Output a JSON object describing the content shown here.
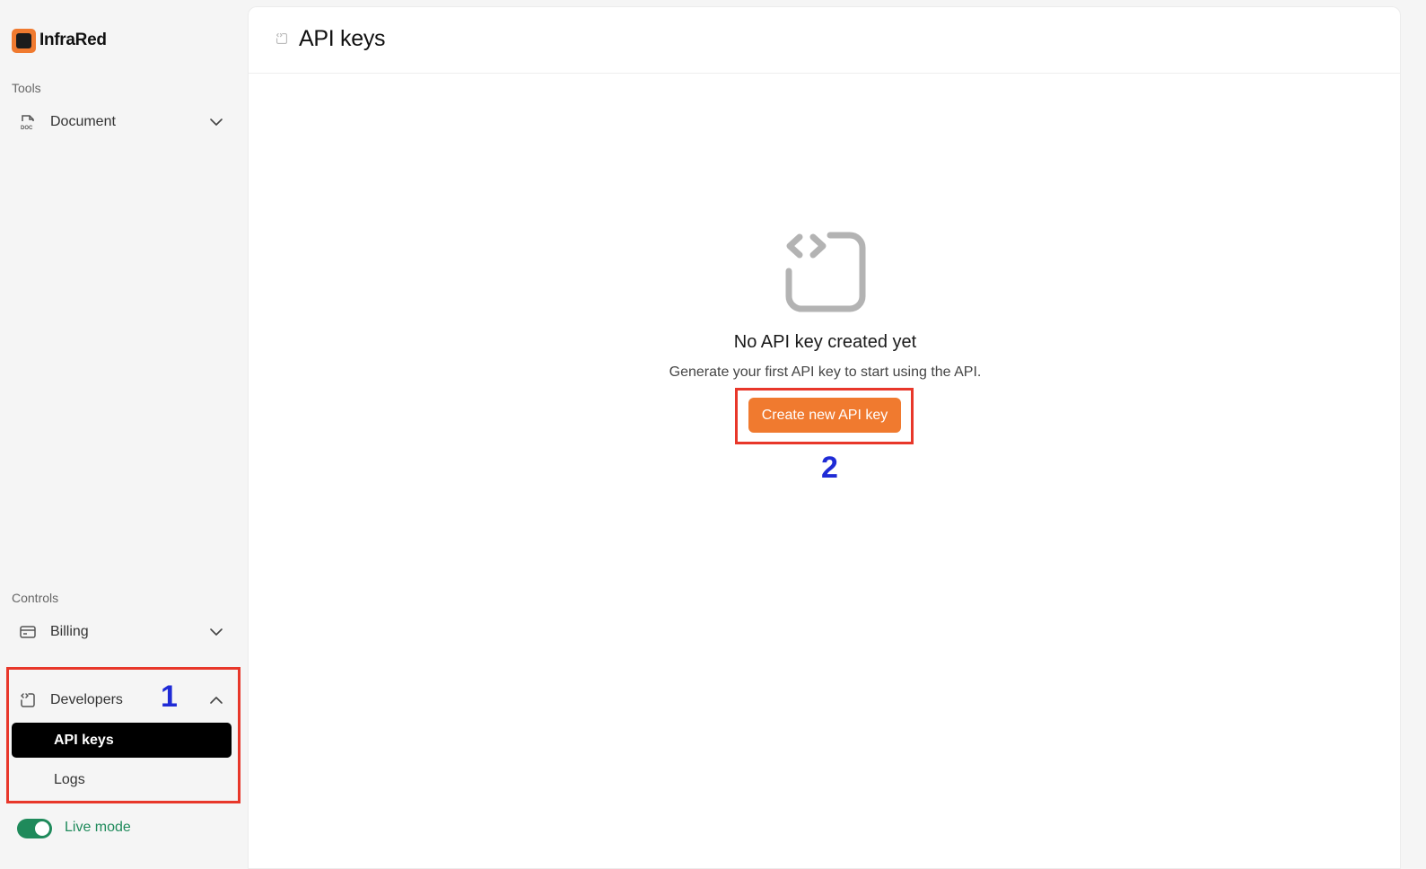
{
  "brand": {
    "name": "InfraRed"
  },
  "sidebar": {
    "tools_label": "Tools",
    "controls_label": "Controls",
    "items": [
      {
        "label": "Document",
        "icon": "doc-file-icon",
        "expanded": false
      },
      {
        "label": "Billing",
        "icon": "credit-card-icon",
        "expanded": false
      },
      {
        "label": "Developers",
        "icon": "code-window-icon",
        "expanded": true
      }
    ],
    "developer_subitems": [
      {
        "label": "API keys",
        "active": true
      },
      {
        "label": "Logs",
        "active": false
      }
    ],
    "live_mode": {
      "label": "Live mode",
      "enabled": true
    }
  },
  "header": {
    "title": "API keys",
    "icon": "code-window-icon"
  },
  "empty_state": {
    "icon": "code-window-icon",
    "title": "No API key created yet",
    "description": "Generate your first API key to start using the API.",
    "button_label": "Create new API key"
  },
  "annotations": [
    {
      "number": "1",
      "target": "developers-section"
    },
    {
      "number": "2",
      "target": "create-api-key-button"
    }
  ],
  "colors": {
    "accent": "#f07a2f",
    "active_bg": "#000000",
    "live": "#1f8a5b",
    "annotation_box": "#e8372a",
    "annotation_number": "#1f2bd6"
  }
}
